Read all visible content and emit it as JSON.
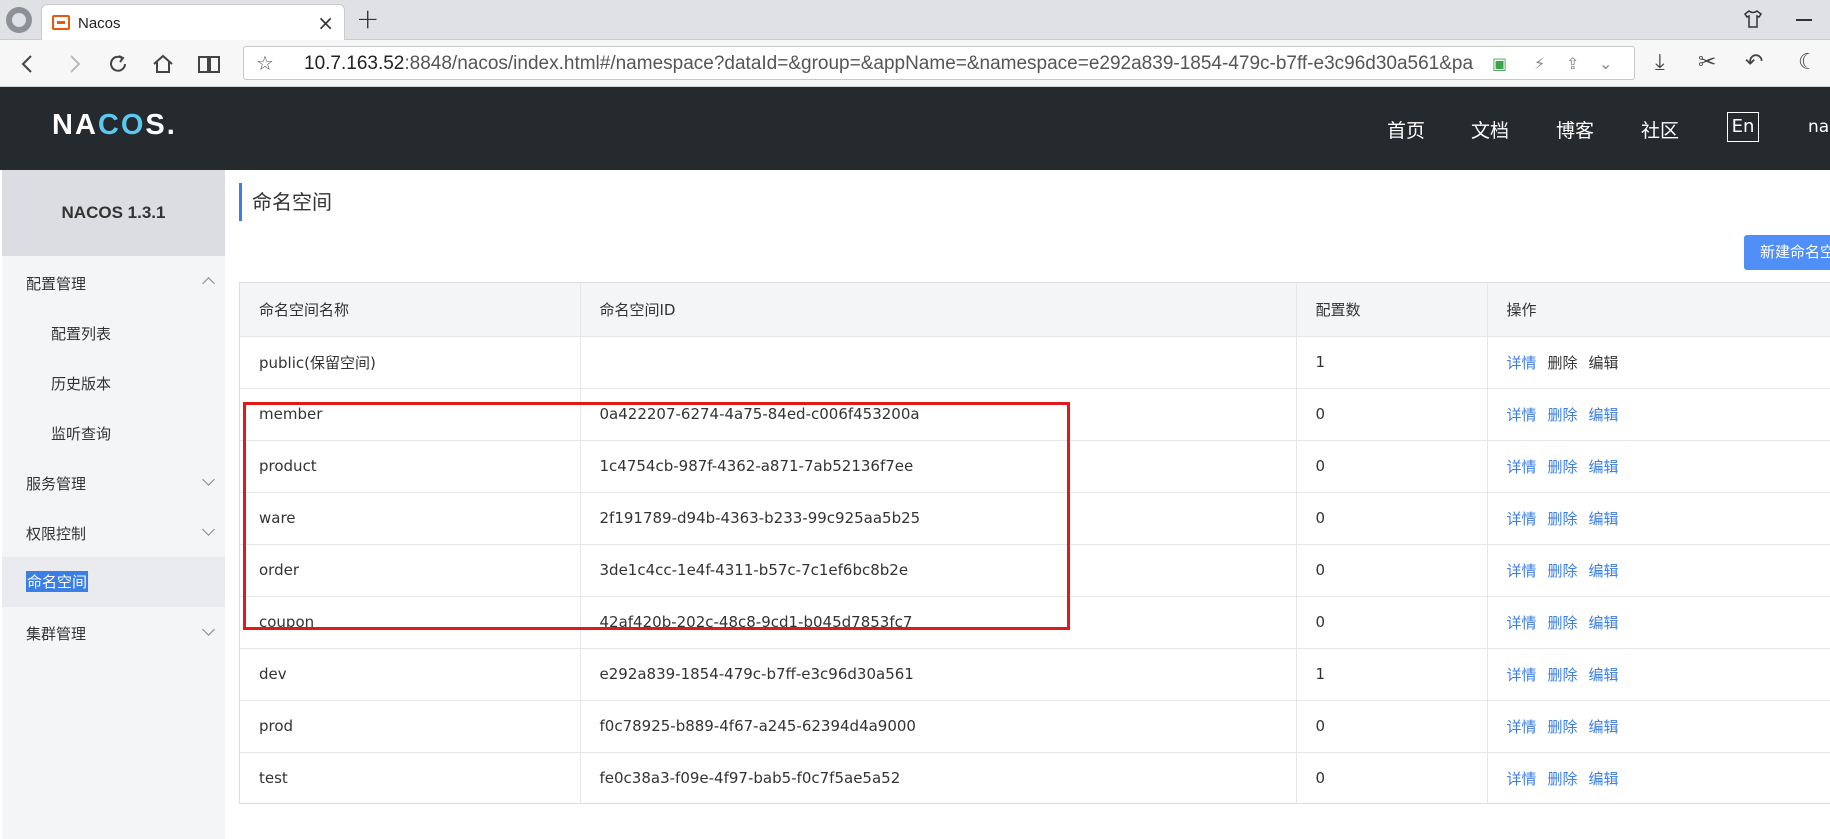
{
  "browser": {
    "tab_title": "Nacos",
    "tab_close": "×",
    "new_tab": "+",
    "url_host": "10.7.163.52",
    "url_rest": ":8848/nacos/index.html#/namespace?dataId=&group=&appName=&namespace=e292a839-1854-479c-b7ff-e3c96d30a561&pa"
  },
  "header": {
    "logo_pre": "NA",
    "logo_mid": "CO",
    "logo_post": "S.",
    "nav": [
      "首页",
      "文档",
      "博客",
      "社区"
    ],
    "lang": "En",
    "user": "nacos"
  },
  "sidebar": {
    "version": "NACOS 1.3.1",
    "items": [
      {
        "label": "配置管理",
        "level": 1,
        "expanded": true
      },
      {
        "label": "配置列表",
        "level": 2
      },
      {
        "label": "历史版本",
        "level": 2
      },
      {
        "label": "监听查询",
        "level": 2
      },
      {
        "label": "服务管理",
        "level": 1,
        "expanded": false
      },
      {
        "label": "权限控制",
        "level": 1,
        "expanded": false
      },
      {
        "label": "命名空间",
        "level": 1,
        "active": true
      },
      {
        "label": "集群管理",
        "level": 1,
        "expanded": false
      }
    ]
  },
  "main": {
    "title": "命名空间",
    "new_button": "新建命名空间",
    "columns": [
      "命名空间名称",
      "命名空间ID",
      "配置数",
      "操作"
    ],
    "actions": [
      "详情",
      "删除",
      "编辑"
    ],
    "rows": [
      {
        "name": "public(保留空间)",
        "id": "",
        "count": "1",
        "reserved": true
      },
      {
        "name": "member",
        "id": "0a422207-6274-4a75-84ed-c006f453200a",
        "count": "0"
      },
      {
        "name": "product",
        "id": "1c4754cb-987f-4362-a871-7ab52136f7ee",
        "count": "0"
      },
      {
        "name": "ware",
        "id": "2f191789-d94b-4363-b233-99c925aa5b25",
        "count": "0"
      },
      {
        "name": "order",
        "id": "3de1c4cc-1e4f-4311-b57c-7c1ef6bc8b2e",
        "count": "0"
      },
      {
        "name": "coupon",
        "id": "42af420b-202c-48c8-9cd1-b045d7853fc7",
        "count": "0"
      },
      {
        "name": "dev",
        "id": "e292a839-1854-479c-b7ff-e3c96d30a561",
        "count": "1"
      },
      {
        "name": "prod",
        "id": "f0c78925-b889-4f67-a245-62394d4a9000",
        "count": "0"
      },
      {
        "name": "test",
        "id": "fe0c38a3-f09e-4f97-bab5-f0c7f5ae5a52",
        "count": "0"
      }
    ]
  },
  "colors": {
    "accent": "#3b7ee6",
    "header_bg": "#252a2f",
    "highlight": "#e01a1a"
  }
}
